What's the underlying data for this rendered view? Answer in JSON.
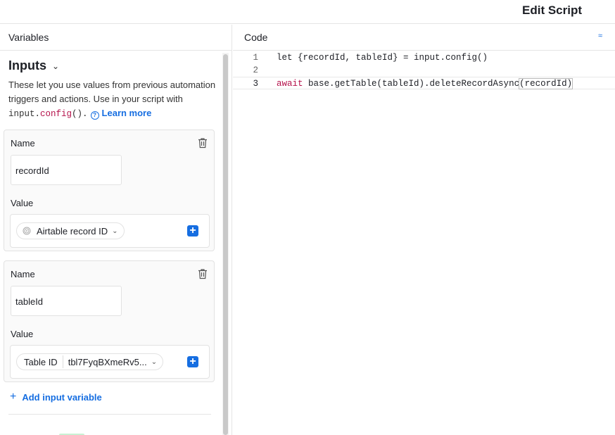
{
  "header": {
    "title": "Edit Script"
  },
  "variables_panel": {
    "title": "Variables",
    "inputs": {
      "title": "Inputs",
      "description_prefix": "These let you use values from previous automation triggers and actions. Use in your script with ",
      "code_obj": "input.",
      "code_kw": "config",
      "code_suffix": "().",
      "learn_more": "Learn more"
    },
    "variables": [
      {
        "name_label": "Name",
        "name": "recordId",
        "value_label": "Value",
        "value_pill": "Airtable record ID"
      },
      {
        "name_label": "Name",
        "name": "tableId",
        "value_label": "Value",
        "value_pill_label": "Table ID",
        "value_pill": "tbl7FyqBXmeRv5..."
      }
    ],
    "add_input": "Add input variable"
  },
  "code_panel": {
    "title": "Code",
    "lines": [
      {
        "num": "1",
        "text": "let {recordId, tableId} = input.config()"
      },
      {
        "num": "2",
        "text": ""
      },
      {
        "num": "3",
        "kw": "await",
        "rest": " base.getTable(tableId).deleteRecordAsync",
        "arg": "(recordId)"
      }
    ]
  },
  "colors": {
    "accent": "#166ee1",
    "keyword": "#b5124b"
  },
  "icons": [
    "chevron-down-icon",
    "question-icon",
    "trash-icon",
    "fingerprint-icon",
    "plus-icon",
    "collaborators-icon"
  ]
}
